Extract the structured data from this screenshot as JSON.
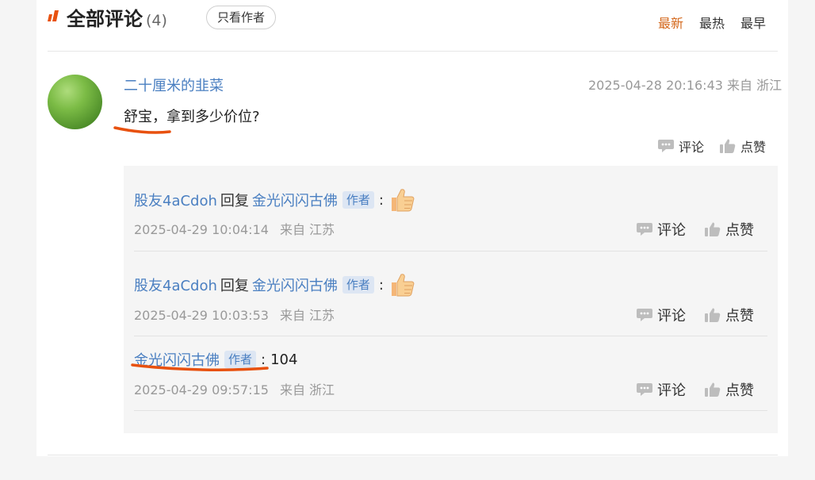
{
  "header": {
    "title": "全部评论",
    "count": "(4)",
    "author_only_label": "只看作者",
    "sort": [
      {
        "label": "最新",
        "active": true
      },
      {
        "label": "最热",
        "active": false
      },
      {
        "label": "最早",
        "active": false
      }
    ]
  },
  "comment": {
    "user": "二十厘米的韭菜",
    "time": "2025-04-28 20:16:43 来自 浙江",
    "content": "舒宝，拿到多少价位?",
    "comment_label": "评论",
    "like_label": "点赞"
  },
  "replies": [
    {
      "user": "股友4aCdoh",
      "reply_word": "回复",
      "target": "金光闪闪古佛",
      "target_badge": "作者",
      "colon": ":",
      "content_icon": "thumbs-up-emoji",
      "time": "2025-04-29 10:04:14",
      "location": "来自 江苏",
      "comment_label": "评论",
      "like_label": "点赞"
    },
    {
      "user": "股友4aCdoh",
      "reply_word": "回复",
      "target": "金光闪闪古佛",
      "target_badge": "作者",
      "colon": ":",
      "content_icon": "thumbs-up-emoji",
      "time": "2025-04-29 10:03:53",
      "location": "来自 江苏",
      "comment_label": "评论",
      "like_label": "点赞"
    },
    {
      "user": "金光闪闪古佛",
      "user_badge": "作者",
      "colon": ":",
      "content": "104",
      "time": "2025-04-29 09:57:15",
      "location": "来自 浙江",
      "comment_label": "评论",
      "like_label": "点赞"
    }
  ],
  "icons": {
    "header": "orange-bars-icon",
    "comment": "speech-bubble-icon",
    "like": "thumbs-up-icon"
  },
  "colors": {
    "accent": "#d4691e",
    "link": "#4a7fc1",
    "annotation": "#e8510f"
  }
}
